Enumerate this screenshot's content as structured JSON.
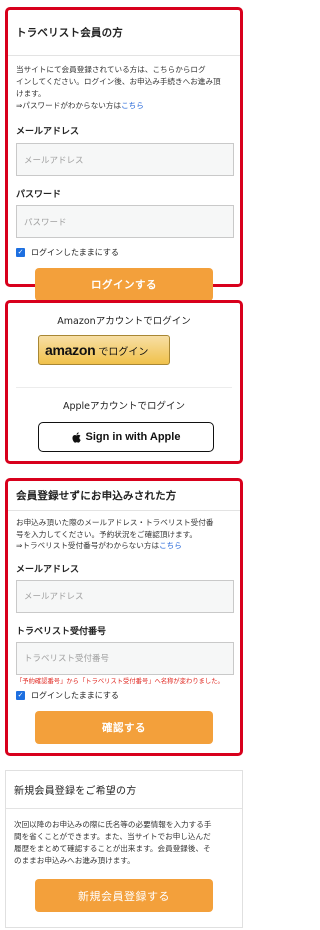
{
  "login": {
    "title": "トラベリスト会員の方",
    "desc_line1": "当サイトにて会員登録されている方は、こちらからログ",
    "desc_line2": "インしてください。ログイン後、お申込み手続きへお進み頂",
    "desc_line3": "けます。",
    "forgot_prefix": "⇒パスワードがわからない方は",
    "forgot_link": "こちら",
    "email_label": "メールアドレス",
    "email_placeholder": "メールアドレス",
    "password_label": "パスワード",
    "password_placeholder": "パスワード",
    "remember_label": "ログインしたままにする",
    "button": "ログインする"
  },
  "social": {
    "amazon_title": "Amazonアカウントでログイン",
    "amazon_logo": "amazon",
    "amazon_button_text": "でログイン",
    "apple_title": "Appleアカウントでログイン",
    "apple_button": "Sign in with Apple"
  },
  "guest": {
    "title": "会員登録せずにお申込みされた方",
    "desc_line1": "お申込み頂いた際のメールアドレス・トラベリスト受付番",
    "desc_line2": "号を入力してください。予約状況をご確認頂けます。",
    "forgot_prefix": "⇒トラベリスト受付番号がわからない方は",
    "forgot_link": "こちら",
    "email_label": "メールアドレス",
    "email_placeholder": "メールアドレス",
    "number_label": "トラベリスト受付番号",
    "number_placeholder": "トラベリスト受付番号",
    "note": "「予約確認番号」から「トラベリスト受付番号」へ名称が変わりました。",
    "remember_label": "ログインしたままにする",
    "button": "確認する"
  },
  "register": {
    "title": "新規会員登録をご希望の方",
    "desc_line1": "次回以降のお申込みの際に氏名等の必要情報を入力する手",
    "desc_line2": "間を省くことができます。また、当サイトでお申し込んだ",
    "desc_line3": "履歴をまとめて確認することが出来ます。会員登録後、そ",
    "desc_line4": "のままお申込みへお進み頂けます。",
    "button": "新規会員登録する"
  },
  "colors": {
    "highlight_border": "#d8001c",
    "orange_button": "#f3a03b",
    "link": "#1a5fd6",
    "amazon_button": "#f0c14b"
  }
}
